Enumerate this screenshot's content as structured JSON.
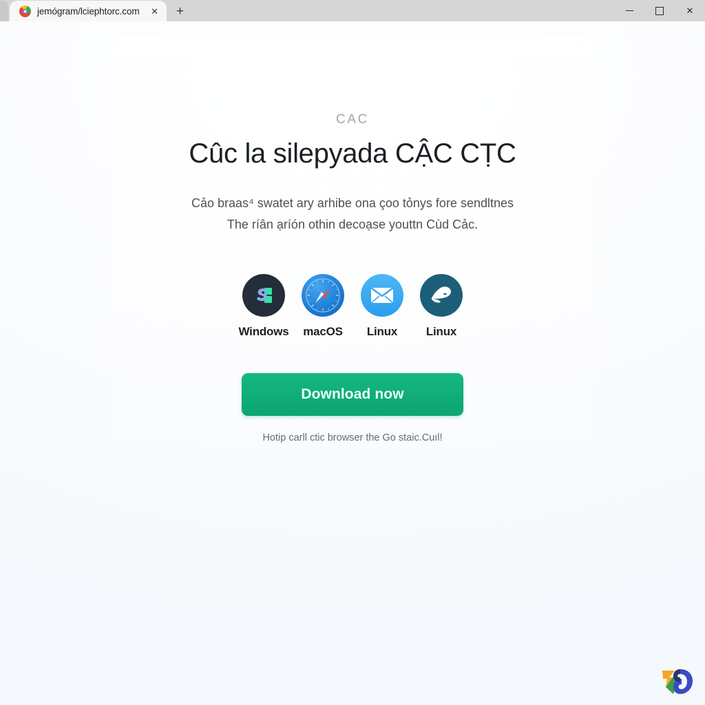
{
  "window": {
    "tab": {
      "title": "jemógram/lciephtorc.com",
      "close_label": "✕",
      "favicon_name": "chrome-favicon"
    },
    "new_tab_label": "+",
    "controls": {
      "minimize_label": "—",
      "maximize_label": "□",
      "close_label": "✕"
    }
  },
  "page": {
    "eyebrow": "CAC",
    "headline": "Cûc la silepyada CẬC CṬC",
    "subcopy_line1": "Cảo braas⁴ swatet ary arhibe ona çoo tỏnys fore sendltnes",
    "subcopy_line2": "The ríân ạríón othin decoạse youttn Cùd Cảc.",
    "platforms": [
      {
        "label": "Windows",
        "icon": "windows-logo-icon",
        "color": "#242d3a"
      },
      {
        "label": "macOS",
        "icon": "safari-compass-icon",
        "color": "#1f7fd6"
      },
      {
        "label": "Linux",
        "icon": "envelope-icon",
        "color": "#2b9ded"
      },
      {
        "label": "Linux",
        "icon": "whale-icon",
        "color": "#1d5f79"
      }
    ],
    "cta_label": "Download now",
    "footnote": "Hotip carll ctic browser the Go staic.Cuıl!"
  },
  "watermark": {
    "name": "brand-leaf-logo",
    "colors": [
      "#f5a623",
      "#3a9e4a",
      "#3b4cc0",
      "#2b3470"
    ]
  }
}
